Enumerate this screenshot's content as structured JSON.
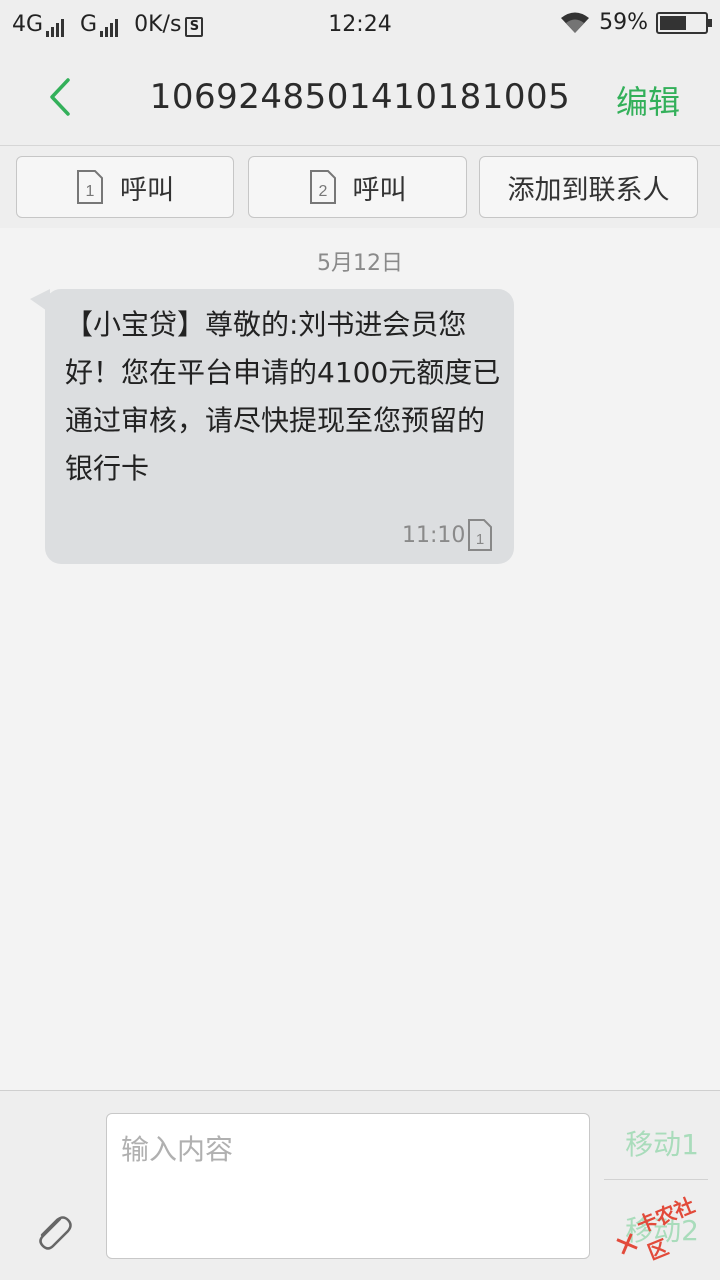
{
  "status_bar": {
    "net1": "4G",
    "net2": "G",
    "speed": "0K/s",
    "sim_badge": "S",
    "time": "12:24",
    "battery": "59%",
    "battery_level": 0.59
  },
  "header": {
    "title": "1069248501410181005",
    "edit_label": "编辑",
    "back_icon": "chevron-left-icon",
    "accent": "#33b05a"
  },
  "actions": {
    "call_sim1": {
      "sim": "1",
      "label": "呼叫"
    },
    "call_sim2": {
      "sim": "2",
      "label": "呼叫"
    },
    "add_contact": "添加到联系人"
  },
  "conversation": {
    "date": "5月12日",
    "messages": [
      {
        "text": "【小宝贷】尊敬的:刘书进会员您好！您在平台申请的4100元额度已通过审核，请尽快提现至您预留的银行卡",
        "time": "11:10",
        "sim": "1"
      }
    ]
  },
  "composer": {
    "placeholder": "输入内容",
    "send_sim1": "移动1",
    "send_sim2": "移动2",
    "attach_icon": "paperclip-icon"
  },
  "watermark": {
    "text": "卡农社区"
  }
}
